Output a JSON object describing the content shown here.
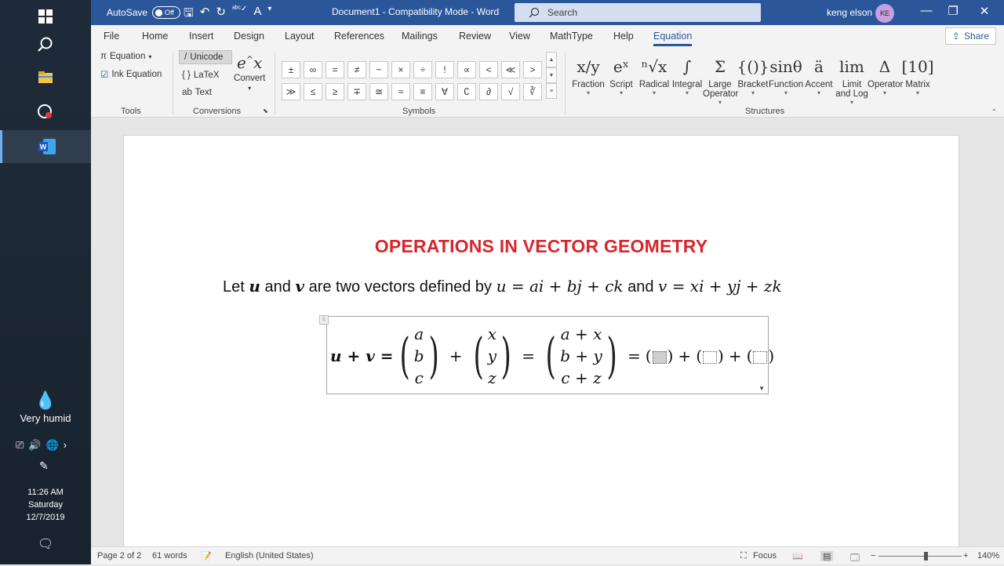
{
  "taskbar": {
    "weather": "Very humid",
    "time": "11:26 AM",
    "day": "Saturday",
    "date": "12/7/2019"
  },
  "titlebar": {
    "autosave_label": "AutoSave",
    "autosave_state": "Off",
    "doc_title": "Document1  -  Compatibility Mode  -  Word",
    "search_placeholder": "Search",
    "user_name": "keng elson",
    "user_initials": "KE"
  },
  "tabs": [
    "File",
    "Home",
    "Insert",
    "Design",
    "Layout",
    "References",
    "Mailings",
    "Review",
    "View",
    "MathType",
    "Help",
    "Equation"
  ],
  "share_label": "Share",
  "ribbon": {
    "tools": {
      "equation": "Equation",
      "ink": "Ink Equation",
      "label": "Tools"
    },
    "conversions": {
      "unicode": "Unicode",
      "latex": "LaTeX",
      "text": "Text",
      "convert": "Convert",
      "label": "Conversions"
    },
    "symbols": {
      "row1": [
        "±",
        "∞",
        "=",
        "≠",
        "~",
        "×",
        "÷",
        "!",
        "∝",
        "<",
        "≪",
        ">"
      ],
      "row2": [
        "≫",
        "≤",
        "≥",
        "∓",
        "≅",
        "≈",
        "≡",
        "∀",
        "∁",
        "∂",
        "√",
        "∛"
      ],
      "label": "Symbols"
    },
    "structures": {
      "items": [
        {
          "icon": "x/y",
          "label": "Fraction"
        },
        {
          "icon": "eˣ",
          "label": "Script"
        },
        {
          "icon": "ⁿ√x",
          "label": "Radical"
        },
        {
          "icon": "∫",
          "label": "Integral"
        },
        {
          "icon": "Σ",
          "label": "Large Operator"
        },
        {
          "icon": "{()}",
          "label": "Bracket"
        },
        {
          "icon": "sinθ",
          "label": "Function"
        },
        {
          "icon": "ä",
          "label": "Accent"
        },
        {
          "icon": "lim",
          "label": "Limit and Log"
        },
        {
          "icon": "Δ",
          "label": "Operator"
        },
        {
          "icon": "[10]",
          "label": "Matrix"
        }
      ],
      "label": "Structures"
    }
  },
  "document": {
    "title": "OPERATIONS IN VECTOR GEOMETRY",
    "intro_text_1": "Let ",
    "intro_u": "u",
    "intro_text_2": " and ",
    "intro_v": "v",
    "intro_text_3": " are two vectors defined by ",
    "intro_eq1": "u = ai + bj + ck",
    "intro_text_4": "  and ",
    "intro_eq2": "v = xi + yj + zk",
    "equation": {
      "lhs": "u + v =",
      "vec1": [
        "a",
        "b",
        "c"
      ],
      "vec2": [
        "x",
        "y",
        "z"
      ],
      "vec3": [
        "a + x",
        "b + y",
        "c + z"
      ]
    }
  },
  "status": {
    "page": "Page 2 of 2",
    "words": "61 words",
    "language": "English (United States)",
    "focus": "Focus",
    "zoom": "140%"
  }
}
